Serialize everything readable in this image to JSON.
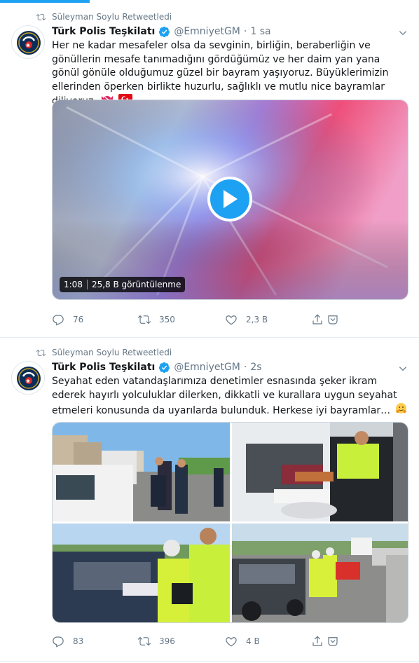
{
  "tweets": [
    {
      "retweeted_by": "Süleyman Soylu Retweetledi",
      "author": {
        "name": "Türk Polis Teşkilatı",
        "handle": "@EmniyetGM",
        "time": "1 sa"
      },
      "text": "Her ne kadar mesafeler olsa da sevginin, birliğin, beraberliğin ve gönüllerin mesafe tanımadığını gördüğümüz ve her daim yan yana gönül gönüle olduğumuz güzel bir bayram yaşıyoruz. Büyüklerimizin ellerinden öperken birlikte huzurlu, sağlıklı ve mutlu nice bayramlar diliyoruz.",
      "emojis": [
        "candy-emoji",
        "turkey-flag-emoji"
      ],
      "video": {
        "duration": "1:08",
        "views": "25,8 B görüntülenme"
      },
      "stats": {
        "replies": "76",
        "retweets": "350",
        "likes": "2,3 B"
      }
    },
    {
      "retweeted_by": "Süleyman Soylu Retweetledi",
      "author": {
        "name": "Türk Polis Teşkilatı",
        "handle": "@EmniyetGM",
        "time": "2s"
      },
      "text": "Seyahat eden vatandaşlarımıza denetimler esnasında şeker ikram ederek hayırlı yolculuklar dilerken, dikkatli ve kurallara uygun seyahat etmeleri konusunda da uyarılarda bulunduk. Herkese iyi bayramlar…",
      "emojis": [
        "hugging-face-emoji"
      ],
      "photos": [
        "police-checkpoint-photo",
        "officer-offering-candy-photo",
        "officers-at-car-window-photo",
        "officers-roadside-traffic-photo"
      ],
      "stats": {
        "replies": "83",
        "retweets": "396",
        "likes": "4 B"
      }
    }
  ],
  "colors": {
    "accent": "#1da1f2",
    "secondary_text": "#657786",
    "border": "#e6ecf0"
  }
}
